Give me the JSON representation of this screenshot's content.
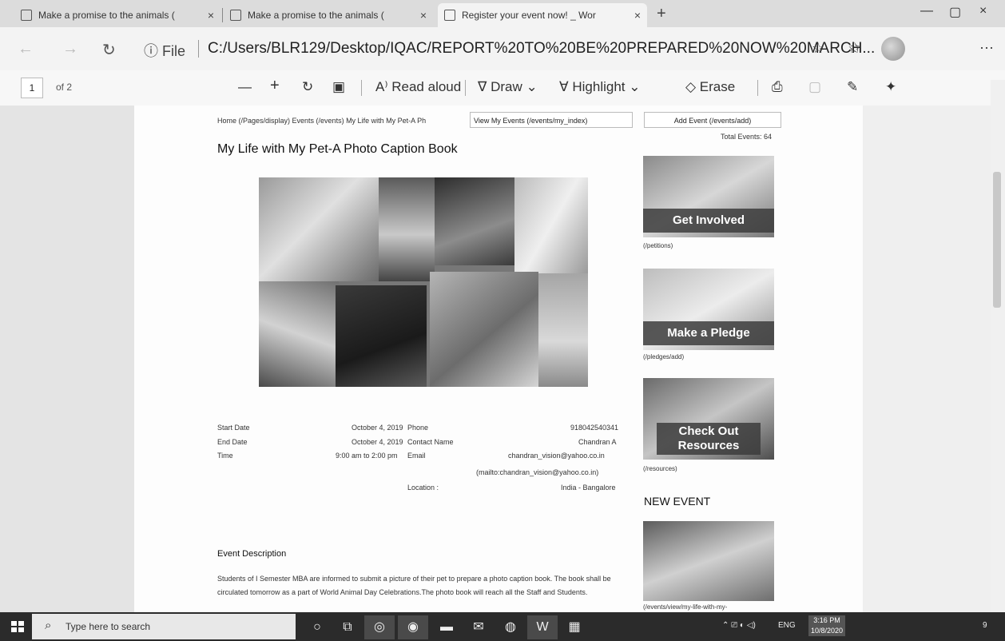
{
  "tabs": [
    {
      "title": "Make a promise to the animals ("
    },
    {
      "title": "Make a promise to the animals ("
    },
    {
      "title": "Register your event now! _ Wor"
    }
  ],
  "window": {
    "close_glyph": "×",
    "min_glyph": "—",
    "max_glyph": "▢"
  },
  "address": {
    "file_label": "ⓘ File",
    "url": "C:/Users/BLR129/Desktop/IQAC/REPORT%20TO%20BE%20PREPARED%20NOW%20MARCH..."
  },
  "pdf_toolbar": {
    "page_current": "1",
    "page_total": "of 2",
    "read_aloud": "Read aloud",
    "draw": "Draw",
    "highlight": "Highlight",
    "erase": "Erase"
  },
  "page": {
    "breadcrumb": "Home (/Pages/display)   Events (/events)   My Life with My Pet-A Ph",
    "view_button": "View My Events (/events/my_index)",
    "add_event_button": "Add Event (/events/add)",
    "total_events": "Total Events: 64",
    "title": "My Life with My Pet-A Photo Caption Book",
    "details": {
      "start_date_label": "Start Date",
      "start_date": "October 4, 2019",
      "end_date_label": "End Date",
      "end_date": "October 4, 2019",
      "time_label": "Time",
      "time": "9:00 am to 2:00 pm",
      "phone_label": "Phone",
      "phone": "918042540341",
      "contact_label": "Contact Name",
      "contact": "Chandran A",
      "email_label": "Email",
      "email": "chandran_vision@yahoo.co.in",
      "email_mailto": "(mailto:chandran_vision@yahoo.co.in)",
      "location_label": "Location :",
      "location": "India - Bangalore"
    },
    "description_heading": "Event Description",
    "description": "Students of I Semester MBA are informed to submit a picture of their pet to prepare a photo caption book. The book shall be circulated tomorrow as a part of World Animal Day Celebrations.The photo book will reach all the Staff and Students.",
    "sidebar": {
      "cards": [
        {
          "label": "Get Involved",
          "link": "(/petitions)"
        },
        {
          "label": "Make a Pledge",
          "link": "(/pledges/add)"
        },
        {
          "label": "Check Out Resources",
          "link": "(/resources)"
        }
      ],
      "new_event_heading": "NEW EVENT",
      "new_event_link": "(/events/view/my-life-with-my-"
    }
  },
  "taskbar": {
    "search_placeholder": "Type here to search",
    "lang": "ENG",
    "time": "3:16 PM",
    "date": "10/8/2020",
    "notif_count": "9"
  }
}
